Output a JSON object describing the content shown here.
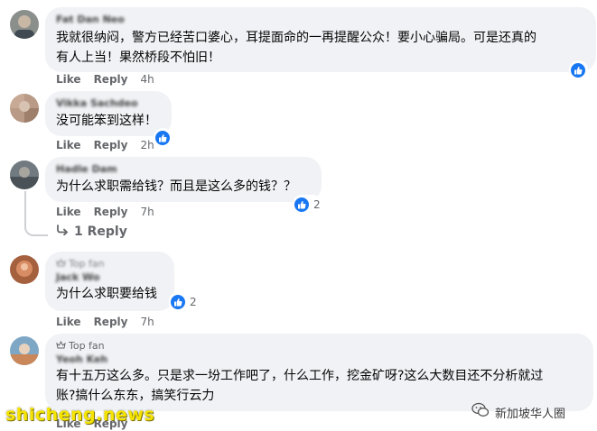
{
  "comments": [
    {
      "id": "c1",
      "author": "Fat Dan Neo",
      "text": "我就很纳闷，警方已经苦口婆心，耳提面命的一再提醒公众！要小心骗局。可是还真的\n有人上当！果然桥段不怕旧！",
      "like_label": "Like",
      "reply_label": "Reply",
      "time": "4h",
      "reaction_count": ""
    },
    {
      "id": "c2",
      "author": "Vikka Sachdeo",
      "text": "没可能笨到这样！",
      "like_label": "Like",
      "reply_label": "Reply",
      "time": "2h",
      "reaction_count": ""
    },
    {
      "id": "c3",
      "author": "Hadle Dam",
      "text": "为什么求职需给钱？而且是这么多的钱？？",
      "like_label": "Like",
      "reply_label": "Reply",
      "time": "7h",
      "reaction_count": "2",
      "replies_link": "1 Reply"
    },
    {
      "id": "c4",
      "badge": "Top fan",
      "author": "Jack Wo",
      "text": "为什么求职要给钱",
      "like_label": "Like",
      "reply_label": "Reply",
      "time": "7h",
      "reaction_count": "2"
    },
    {
      "id": "c5",
      "badge": "Top fan",
      "author": "Yeoh Keh",
      "text": "有十五万这么多。只是求一坋工作吧了，什么工作，挖金矿呀?这么大数目还不分析就过\n账?搞什么东东，搞笑行云力",
      "like_label": "Like",
      "reply_label": "Reply",
      "time": ""
    }
  ],
  "watermarks": {
    "left": "shicheng.news",
    "right": "新加坡华人圈"
  },
  "colors": {
    "bubble": "#f0f2f5",
    "like_blue": "#1877f2",
    "meta_gray": "#65676b",
    "watermark_yellow": "#f5e400"
  },
  "icons": {
    "reaction": "like-thumb-icon",
    "reply_arrow": "reply-arrow-icon",
    "top_fan": "top-fan-badge-icon",
    "wechat": "wechat-icon"
  }
}
